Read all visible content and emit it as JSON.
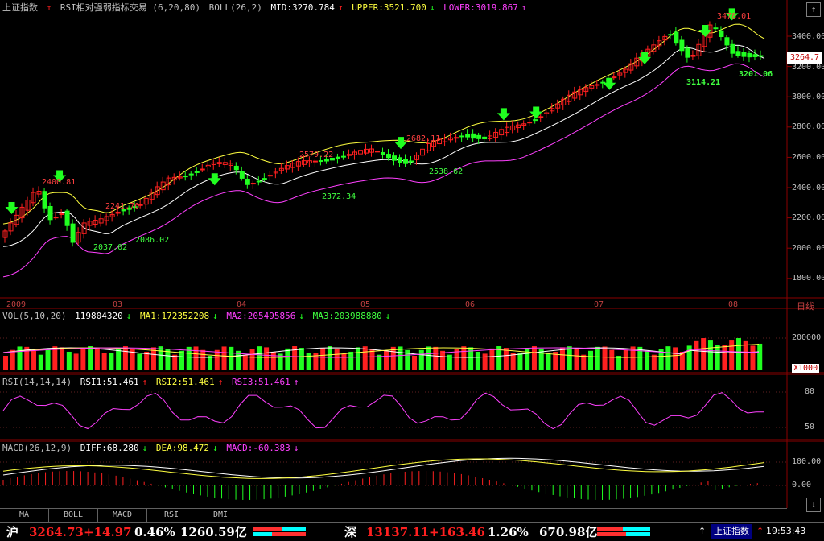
{
  "header": {
    "index_name": "上证指数",
    "indicator_title": "RSI相对强弱指标交易 (6,20,80)",
    "boll_label": "BOLL(26,2)",
    "mid": "MID:3270.784",
    "upper": "UPPER:3521.700",
    "lower": "LOWER:3019.867"
  },
  "vol_header": {
    "label": "VOL(5,10,20)",
    "value": "119804320",
    "ma1": "MA1:172352208",
    "ma2": "MA2:205495856",
    "ma3": "MA3:203988880"
  },
  "rsi_header": {
    "label": "RSI(14,14,14)",
    "rsi1": "RSI1:51.461",
    "rsi2": "RSI2:51.461",
    "rsi3": "RSI3:51.461"
  },
  "macd_header": {
    "label": "MACD(26,12,9)",
    "diff": "DIFF:68.280",
    "dea": "DEA:98.472",
    "macd": "MACD:-60.383"
  },
  "price_axis": [
    "3400.00",
    "3200.00",
    "3000.00",
    "2800.00",
    "2600.00",
    "2400.00",
    "2200.00",
    "2000.00",
    "1800.00"
  ],
  "current_price": "3264.7",
  "period_label": "日线",
  "x_labels": [
    "2009",
    "03",
    "04",
    "05",
    "06",
    "07",
    "08"
  ],
  "vol_axis": [
    "200000",
    "X1000"
  ],
  "rsi_axis": [
    "80",
    "50"
  ],
  "macd_axis": [
    "100.00",
    "0.00"
  ],
  "annotations": [
    {
      "text": "2400.81",
      "color": "#ff4040"
    },
    {
      "text": "2241.76",
      "color": "#ff4040"
    },
    {
      "text": "2037.02",
      "color": "#40ff40"
    },
    {
      "text": "2086.02",
      "color": "#40ff40"
    },
    {
      "text": "2579.22",
      "color": "#ff4040"
    },
    {
      "text": "2372.34",
      "color": "#40ff40"
    },
    {
      "text": "2682.11",
      "color": "#ff4040"
    },
    {
      "text": "2538.62",
      "color": "#40ff40"
    },
    {
      "text": "3478.01",
      "color": "#ff4040"
    },
    {
      "text": "3114.21",
      "color": "#40ff40"
    },
    {
      "text": "3201.06",
      "color": "#40ff40"
    }
  ],
  "tabs": [
    "MA",
    "BOLL",
    "MACD",
    "RSI",
    "DMI"
  ],
  "status": {
    "sh_label": "沪",
    "sh_price": "3264.73",
    "sh_change": "+14.97",
    "sh_pct": "0.46%",
    "sh_amount": "1260.59亿",
    "sz_label": "深",
    "sz_price": "13137.11",
    "sz_change": "+163.46",
    "sz_pct": "1.26%",
    "sz_amount": "670.98亿",
    "ticker": "上证指数",
    "time": "19:53:43"
  },
  "colors": {
    "up": "#ff2020",
    "down": "#20ff20",
    "upper": "#ffff40",
    "mid": "#ffffff",
    "lower": "#ff40ff"
  }
}
